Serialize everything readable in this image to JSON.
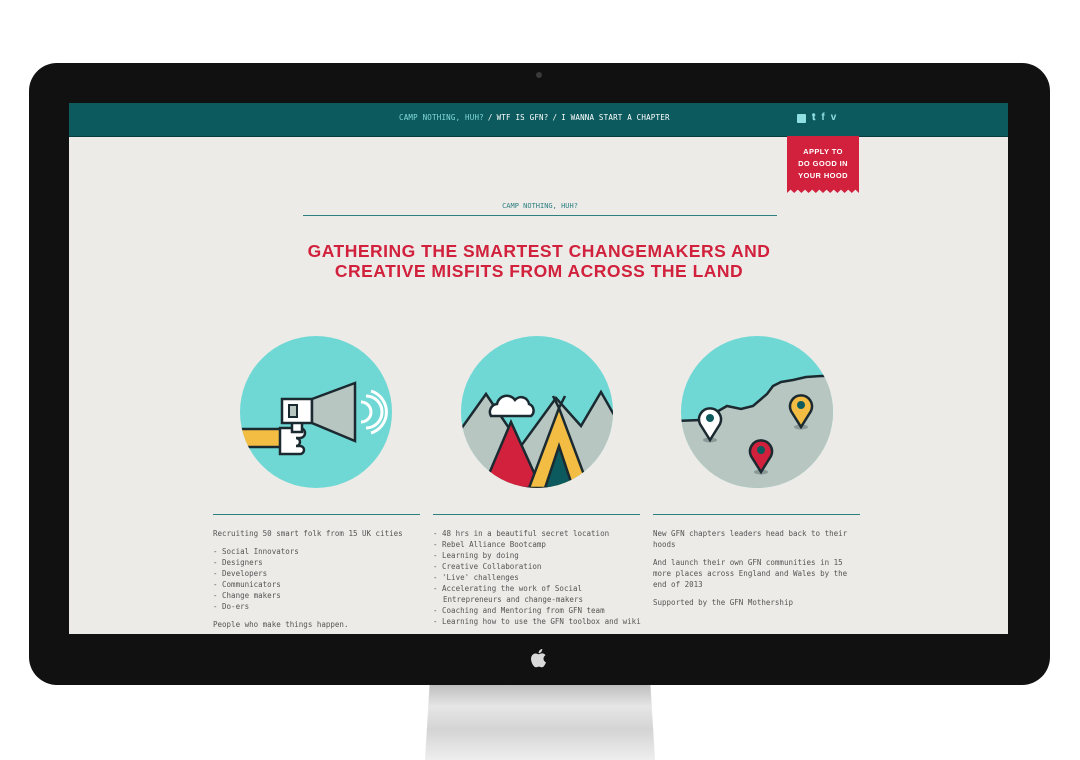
{
  "nav": {
    "links": [
      "CAMP NOTHING, HUH?",
      "WTF IS GFN?",
      "I WANNA START A CHAPTER"
    ],
    "separator": "/"
  },
  "social": {
    "icons": [
      "instagram-icon",
      "twitter-icon",
      "facebook-icon",
      "vimeo-icon"
    ],
    "twitter": "𝐭",
    "facebook": "f",
    "vimeo": "v"
  },
  "apply_button": "APPLY TO\nDO GOOD IN\nYOUR HOOD",
  "section_title": "CAMP NOTHING, HUH?",
  "headline": [
    "GATHERING THE SMARTEST CHANGEMAKERS AND",
    "CREATIVE MISFITS FROM ACROSS THE LAND"
  ],
  "colors": {
    "nav_bg": "#0d5a5e",
    "accent_red": "#d1213c",
    "teal_circle": "#6fd8d4",
    "page_bg": "#ecebe8",
    "yellow": "#f2bd42",
    "grey": "#b8c6c2"
  },
  "columns": [
    {
      "intro": "Recruiting 50 smart folk from 15 UK cities",
      "items": [
        "- Social Innovators",
        "- Designers",
        "- Developers",
        "- Communicators",
        "- Change makers",
        "- Do-ers"
      ],
      "outro": "People who make things happen."
    },
    {
      "items": [
        "- 48 hrs in a beautiful secret location",
        "- Rebel Alliance Bootcamp",
        "- Learning by doing",
        "- Creative Collaboration",
        "- 'Live' challenges",
        "- Accelerating the work of Social Entrepreneurs and change-makers",
        "- Coaching and Mentoring from GFN team",
        "- Learning how to use the GFN toolbox and wiki"
      ]
    },
    {
      "paragraphs": [
        "New GFN chapters leaders head back to their hoods",
        "And launch their own GFN communities in 15 more places across England and Wales by the end of 2013",
        "Supported by the GFN Mothership"
      ]
    }
  ]
}
